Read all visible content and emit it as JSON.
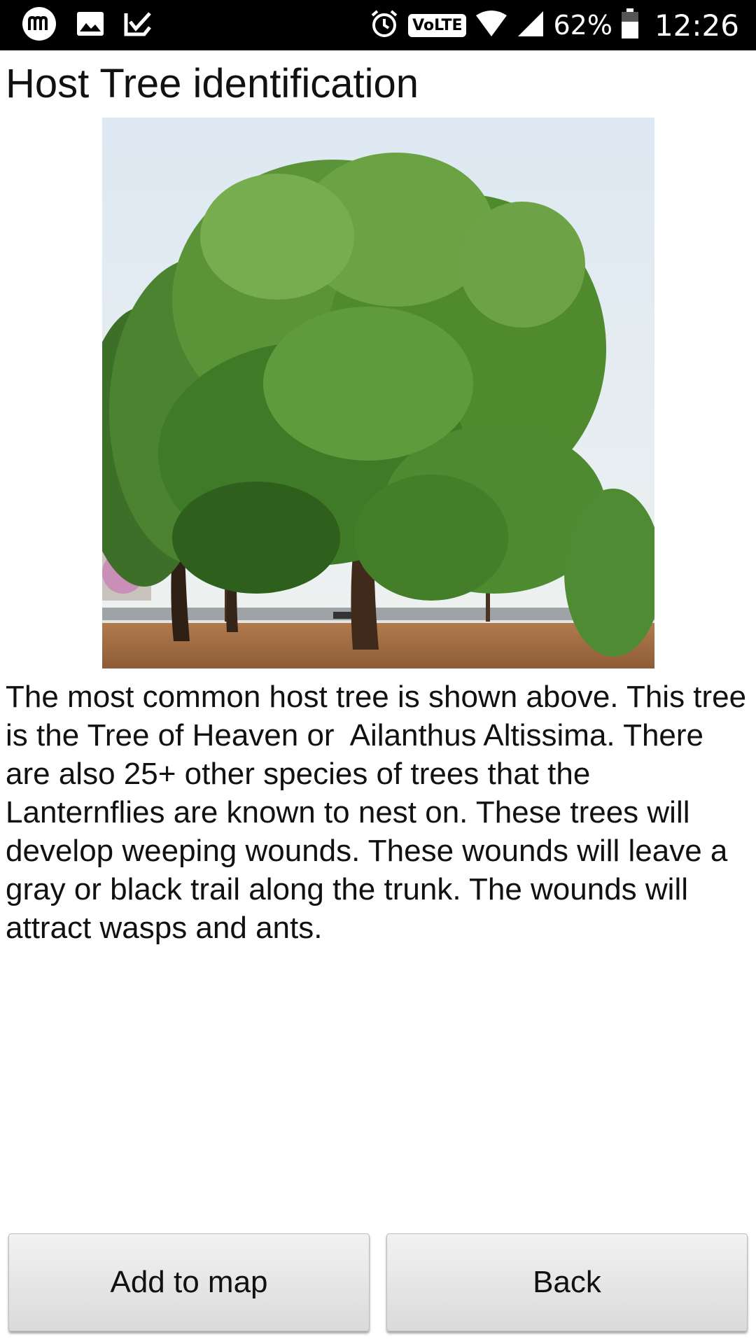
{
  "status_bar": {
    "icons_left": [
      "m-app-icon",
      "image-icon",
      "check-notification-icon"
    ],
    "icons_right": [
      "alarm-icon",
      "volte-icon",
      "wifi-icon",
      "signal-icon",
      "battery-icon"
    ],
    "volte_label": "VoLTE",
    "battery_percent": "62%",
    "time": "12:26"
  },
  "page": {
    "title": "Host Tree identification",
    "description": "The most common host tree is shown above. This tree is the Tree of Heaven or  Ailanthus Altissima. There are also 25+ other species of trees that the Lanternflies are known to nest on. These trees will develop weeping wounds. These wounds will leave a gray or black trail along the trunk. The wounds will attract wasps and ants."
  },
  "buttons": {
    "add_to_map": "Add to map",
    "back": "Back"
  },
  "colors": {
    "status_bar_bg": "#000000",
    "button_bg": "#e6e6e6",
    "sky": "#dfe9f1",
    "foliage": "#4f8a2f",
    "ground": "#a8744a"
  }
}
